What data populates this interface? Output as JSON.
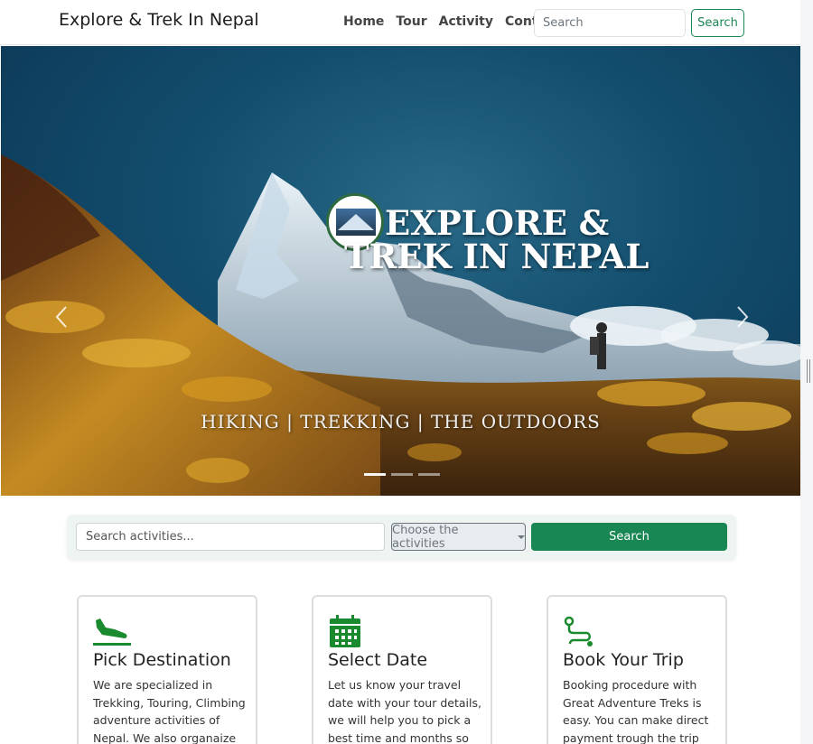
{
  "navbar": {
    "brand": "Explore & Trek In Nepal",
    "links": [
      "Home",
      "Tour",
      "Activity",
      "Contact"
    ],
    "search_placeholder": "Search",
    "search_button": "Search"
  },
  "hero": {
    "title_line1": "EXPLORE &",
    "title_line2": "TREK IN NEPAL",
    "caption": "HIKING | TREKKING | THE OUTDOORS",
    "slide_count": 3,
    "active_slide": 1
  },
  "activity_search": {
    "placeholder": "Search activities...",
    "dropdown_label": "Choose the activities",
    "button": "Search"
  },
  "cards": [
    {
      "icon": "plane-landing-icon",
      "title": "Pick Destination",
      "text": "We are specialized in Trekking, Touring, Climbing adventure activities of Nepal. We also organaize"
    },
    {
      "icon": "calendar-icon",
      "title": "Select Date",
      "text": "Let us know your travel date with your tour details, we will help you to pick a best time and months so that"
    },
    {
      "icon": "route-icon",
      "title": "Book Your Trip",
      "text": "Booking procedure with Great Adventure Treks is easy. You can make direct payment trough the trip url."
    }
  ],
  "colors": {
    "accent_green": "#198754",
    "icon_green": "#1a8a2f",
    "sky": "#134e6f"
  }
}
